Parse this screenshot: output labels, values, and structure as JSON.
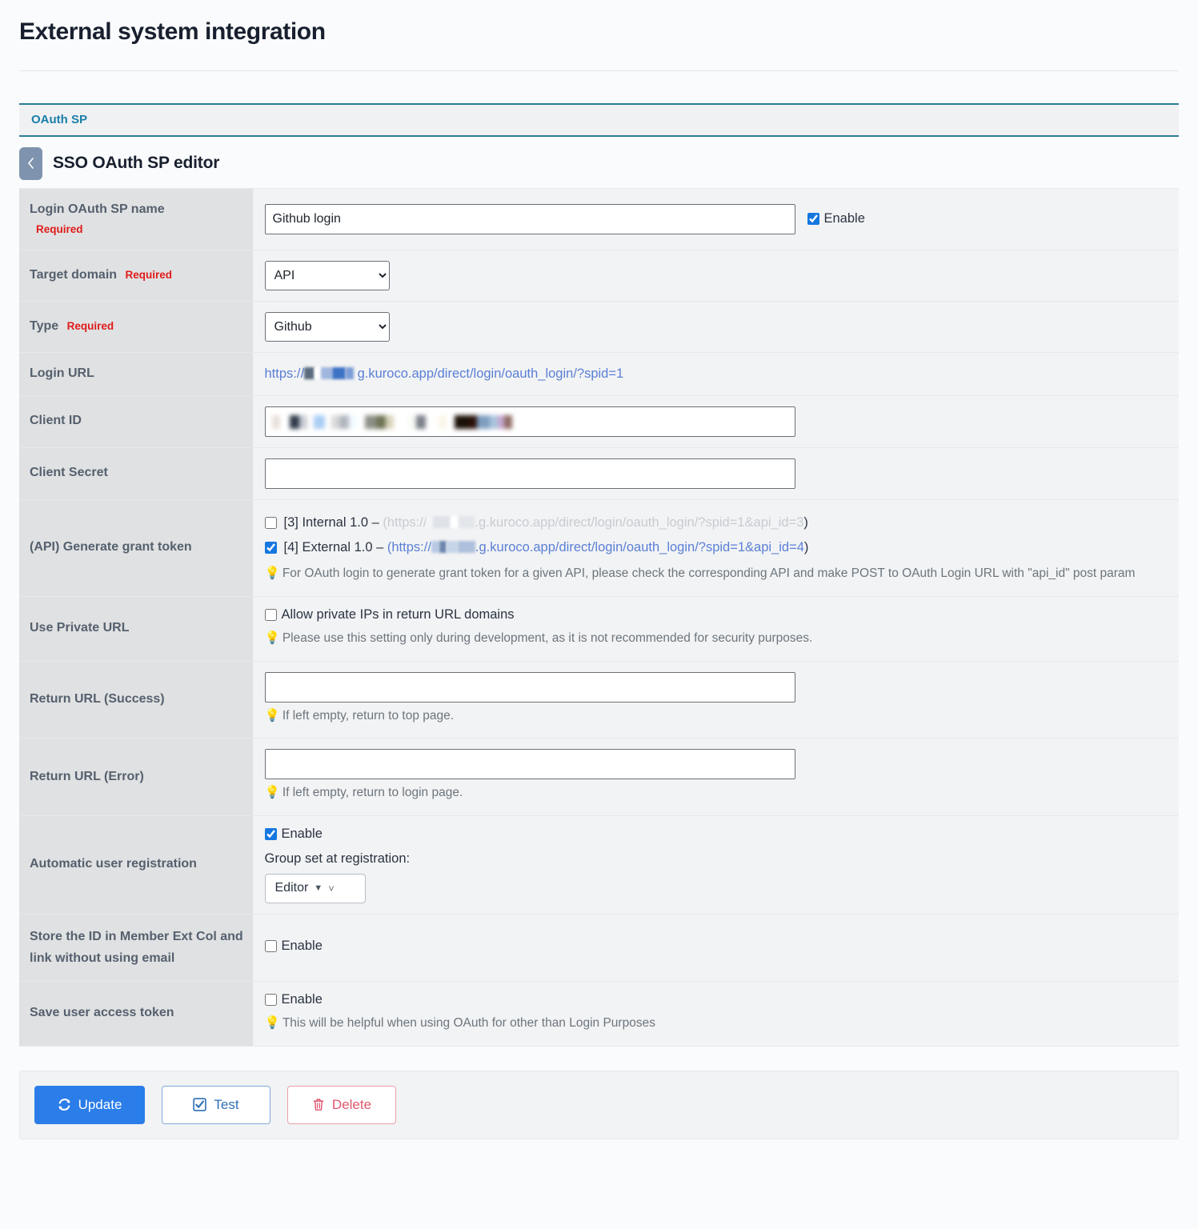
{
  "header": {
    "title": "External system integration"
  },
  "tabs": [
    {
      "label": "OAuth SP"
    }
  ],
  "section": {
    "title": "SSO OAuth SP editor",
    "back_icon": "chevron-left-icon"
  },
  "form": {
    "required_label": "Required",
    "rows": {
      "sp_name": {
        "label": "Login OAuth SP name",
        "value": "Github login",
        "placeholder": "",
        "enable_label": "Enable",
        "enabled": true
      },
      "target_domain": {
        "label": "Target domain",
        "value": "API",
        "options": [
          "API"
        ]
      },
      "type": {
        "label": "Type",
        "value": "Github",
        "options": [
          "Github"
        ]
      },
      "login_url": {
        "label": "Login URL",
        "prefix": "https://",
        "redacted": "[redacted]",
        "suffix": "g.kuroco.app/direct/login/oauth_login/?spid=1"
      },
      "client_id": {
        "label": "Client ID",
        "value": "[redacted]",
        "placeholder": ""
      },
      "client_secret": {
        "label": "Client Secret",
        "value": "",
        "placeholder": ""
      },
      "grant_token": {
        "label": "(API) Generate grant token",
        "items": [
          {
            "id": "[3]",
            "name": "Internal 1.0",
            "dash": "–",
            "url_prefix": "(https://",
            "url_redacted": "[redacted]",
            "url_suffix": ".g.kuroco.app/direct/login/oauth_login/?spid=1&api_id=3",
            "url_close": ")",
            "checked": false
          },
          {
            "id": "[4]",
            "name": "External 1.0",
            "dash": "–",
            "url_prefix": "(https://",
            "url_redacted": "[redacted]",
            "url_suffix": ".g.kuroco.app/direct/login/oauth_login/?spid=1&api_id=4",
            "url_close": ")",
            "checked": true
          }
        ],
        "hint": "For OAuth login to generate grant token for a given API, please check the corresponding API and make POST to OAuth Login URL with \"api_id\" post param"
      },
      "private_url": {
        "label": "Use Private URL",
        "checkbox_label": "Allow private IPs in return URL domains",
        "checked": false,
        "hint": "Please use this setting only during development, as it is not recommended for security purposes."
      },
      "return_success": {
        "label": "Return URL (Success)",
        "value": "",
        "placeholder": "",
        "hint": "If left empty, return to top page."
      },
      "return_error": {
        "label": "Return URL (Error)",
        "value": "",
        "placeholder": "",
        "hint": "If left empty, return to login page."
      },
      "auto_registration": {
        "label": "Automatic user registration",
        "enable_label": "Enable",
        "enabled": true,
        "group_label": "Group set at registration:",
        "group_value": "Editor",
        "group_options": [
          "Editor"
        ]
      },
      "store_id": {
        "label": "Store the ID in Member Ext Col and link without using email",
        "enable_label": "Enable",
        "enabled": false
      },
      "save_token": {
        "label": "Save user access token",
        "enable_label": "Enable",
        "enabled": false,
        "hint": "This will be helpful when using OAuth for other than Login Purposes"
      }
    }
  },
  "actions": {
    "update": {
      "label": "Update",
      "icon": "refresh-icon"
    },
    "test": {
      "label": "Test",
      "icon": "checkbox-icon"
    },
    "delete": {
      "label": "Delete",
      "icon": "trash-icon"
    }
  },
  "colors": {
    "accent_blue": "#2b7de9",
    "tab_teal": "#2b7d96",
    "required_red": "#e01b1b",
    "hint_orange": "#f26522",
    "danger_red": "#e0566d"
  }
}
